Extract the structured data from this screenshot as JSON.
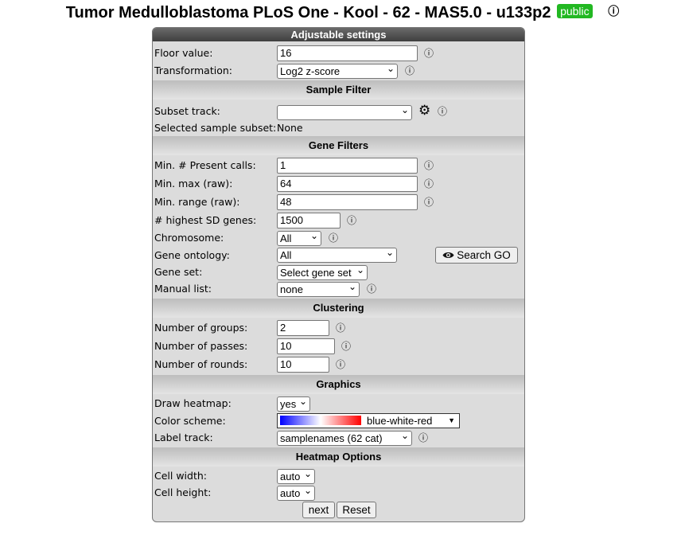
{
  "page": {
    "title": "Tumor Medulloblastoma PLoS One - Kool - 62 - MAS5.0 - u133p2",
    "badge": "public",
    "info_glyph": "ⓘ"
  },
  "panel": {
    "header": "Adjustable settings"
  },
  "settings": {
    "floor_label": "Floor value:",
    "floor_value": "16",
    "transform_label": "Transformation:",
    "transform_value": "Log2 z-score"
  },
  "sample_filter": {
    "title": "Sample Filter",
    "subset_label": "Subset track:",
    "subset_value": "",
    "selected_label": "Selected sample subset:",
    "selected_value": "None"
  },
  "gene_filters": {
    "title": "Gene Filters",
    "present_label": "Min. # Present calls:",
    "present_value": "1",
    "max_label": "Min. max (raw):",
    "max_value": "64",
    "range_label": "Min. range (raw):",
    "range_value": "48",
    "sd_label": "# highest SD genes:",
    "sd_value": "1500",
    "chrom_label": "Chromosome:",
    "chrom_value": "All",
    "ontology_label": "Gene ontology:",
    "ontology_value": "All",
    "search_go_label": "Search GO",
    "geneset_label": "Gene set:",
    "geneset_value": "Select gene set",
    "manual_label": "Manual list:",
    "manual_value": "none"
  },
  "clustering": {
    "title": "Clustering",
    "groups_label": "Number of groups:",
    "groups_value": "2",
    "passes_label": "Number of passes:",
    "passes_value": "10",
    "rounds_label": "Number of rounds:",
    "rounds_value": "10"
  },
  "graphics": {
    "title": "Graphics",
    "heatmap_label": "Draw heatmap:",
    "heatmap_value": "yes",
    "color_label": "Color scheme:",
    "color_value": "blue-white-red",
    "labeltrack_label": "Label track:",
    "labeltrack_value": "samplenames (62 cat)"
  },
  "heatmap_options": {
    "title": "Heatmap Options",
    "cellwidth_label": "Cell width:",
    "cellwidth_value": "auto",
    "cellheight_label": "Cell height:",
    "cellheight_value": "auto"
  },
  "buttons": {
    "next": "next",
    "reset": "Reset"
  },
  "colors": {
    "badge": "#22b822",
    "header": "#4f4f4f",
    "panel": "#dcdcdc"
  },
  "icons": {
    "info": "info-icon",
    "gear": "gear-icon",
    "eye": "eye-icon",
    "dropdown": "chevron-down-icon"
  }
}
